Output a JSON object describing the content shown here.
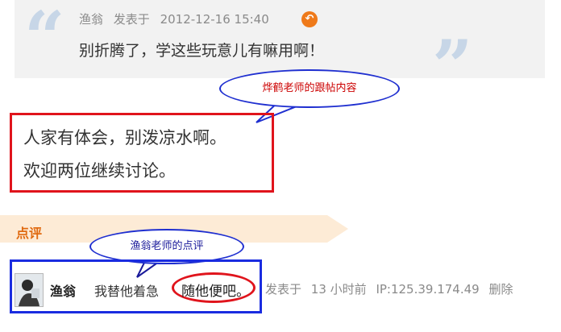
{
  "quote": {
    "author": "渔翁",
    "posted_label": "发表于",
    "timestamp": "2012-12-16 15:40",
    "text": "别折腾了，学这些玩意儿有嘛用啊！",
    "reply_icon": "reply-arrow-icon",
    "open_quote": "“",
    "close_quote": "”"
  },
  "annotations": {
    "reply_bubble": "烨鹤老师的跟帖内容",
    "comment_bubble": "渔翁老师的点评"
  },
  "reply": {
    "line1": "人家有体会，别泼凉水啊。",
    "line2": "欢迎两位继续讨论。"
  },
  "comment_section": {
    "header": "点评",
    "author": "渔翁",
    "text_prefix": "我替他着急",
    "text_highlight": "随他便吧。",
    "posted_label": "发表于",
    "time_ago": "13 小时前",
    "ip": "IP:125.39.174.49",
    "delete_label": "删除"
  },
  "colors": {
    "accent_orange": "#e06a10",
    "highlight_red": "#e0141c",
    "annotation_blue": "#1a2ce0"
  }
}
